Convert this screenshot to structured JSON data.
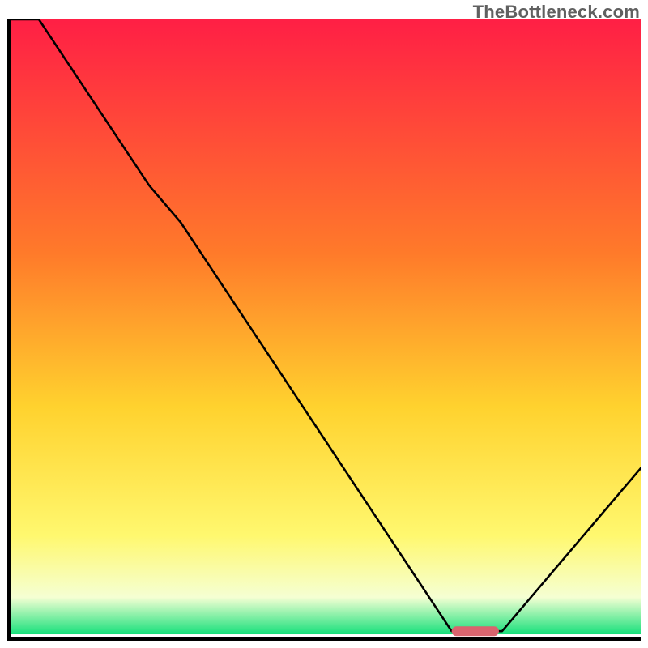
{
  "watermark": "TheBottleneck.com",
  "colors": {
    "gradient_top": "#ff1f45",
    "gradient_mid1": "#ff7a2a",
    "gradient_mid2": "#ffd22e",
    "gradient_mid3": "#fff86f",
    "gradient_mid4": "#f5ffd3",
    "gradient_bot": "#17e07b",
    "line": "#000000",
    "marker_fill": "#d9646e",
    "axis": "#000000"
  },
  "chart_data": {
    "type": "line",
    "title": "",
    "xlabel": "",
    "ylabel": "",
    "xlim": [
      0,
      100
    ],
    "ylim": [
      0,
      100
    ],
    "x": [
      0,
      4.5,
      22,
      27,
      70,
      78,
      100
    ],
    "values": [
      100,
      100,
      73,
      67,
      0.5,
      0.5,
      27
    ],
    "marker": {
      "x_range": [
        70,
        77.5
      ],
      "y": 0.5
    },
    "grid": false,
    "legend": false
  }
}
